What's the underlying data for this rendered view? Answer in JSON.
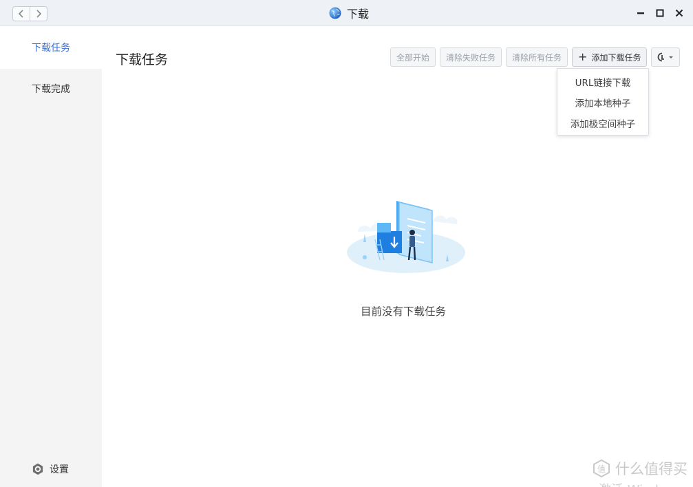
{
  "window": {
    "title": "下载",
    "controls": {
      "minimize": "minimize-icon",
      "maximize": "maximize-icon",
      "close": "close-icon"
    },
    "nav": {
      "back": "chevron-left-icon",
      "forward": "chevron-right-icon"
    }
  },
  "sidebar": {
    "items": [
      {
        "label": "下载任务",
        "active": true
      },
      {
        "label": "下载完成",
        "active": false
      }
    ],
    "settings_label": "设置"
  },
  "main": {
    "title": "下载任务",
    "toolbar": {
      "start_all": "全部开始",
      "clear_failed": "清除失败任务",
      "clear_all": "清除所有任务",
      "add_download": "添加下载任务"
    },
    "add_menu": [
      "URL链接下载",
      "添加本地种子",
      "添加极空间种子"
    ],
    "empty_text": "目前没有下载任务"
  },
  "watermark": {
    "text": "什么值得买",
    "overlay": "激活 Windows"
  },
  "colors": {
    "accent": "#3a6fd8",
    "sidebar_bg": "#f4f4f5",
    "titlebar_bg": "#eef1f6"
  }
}
